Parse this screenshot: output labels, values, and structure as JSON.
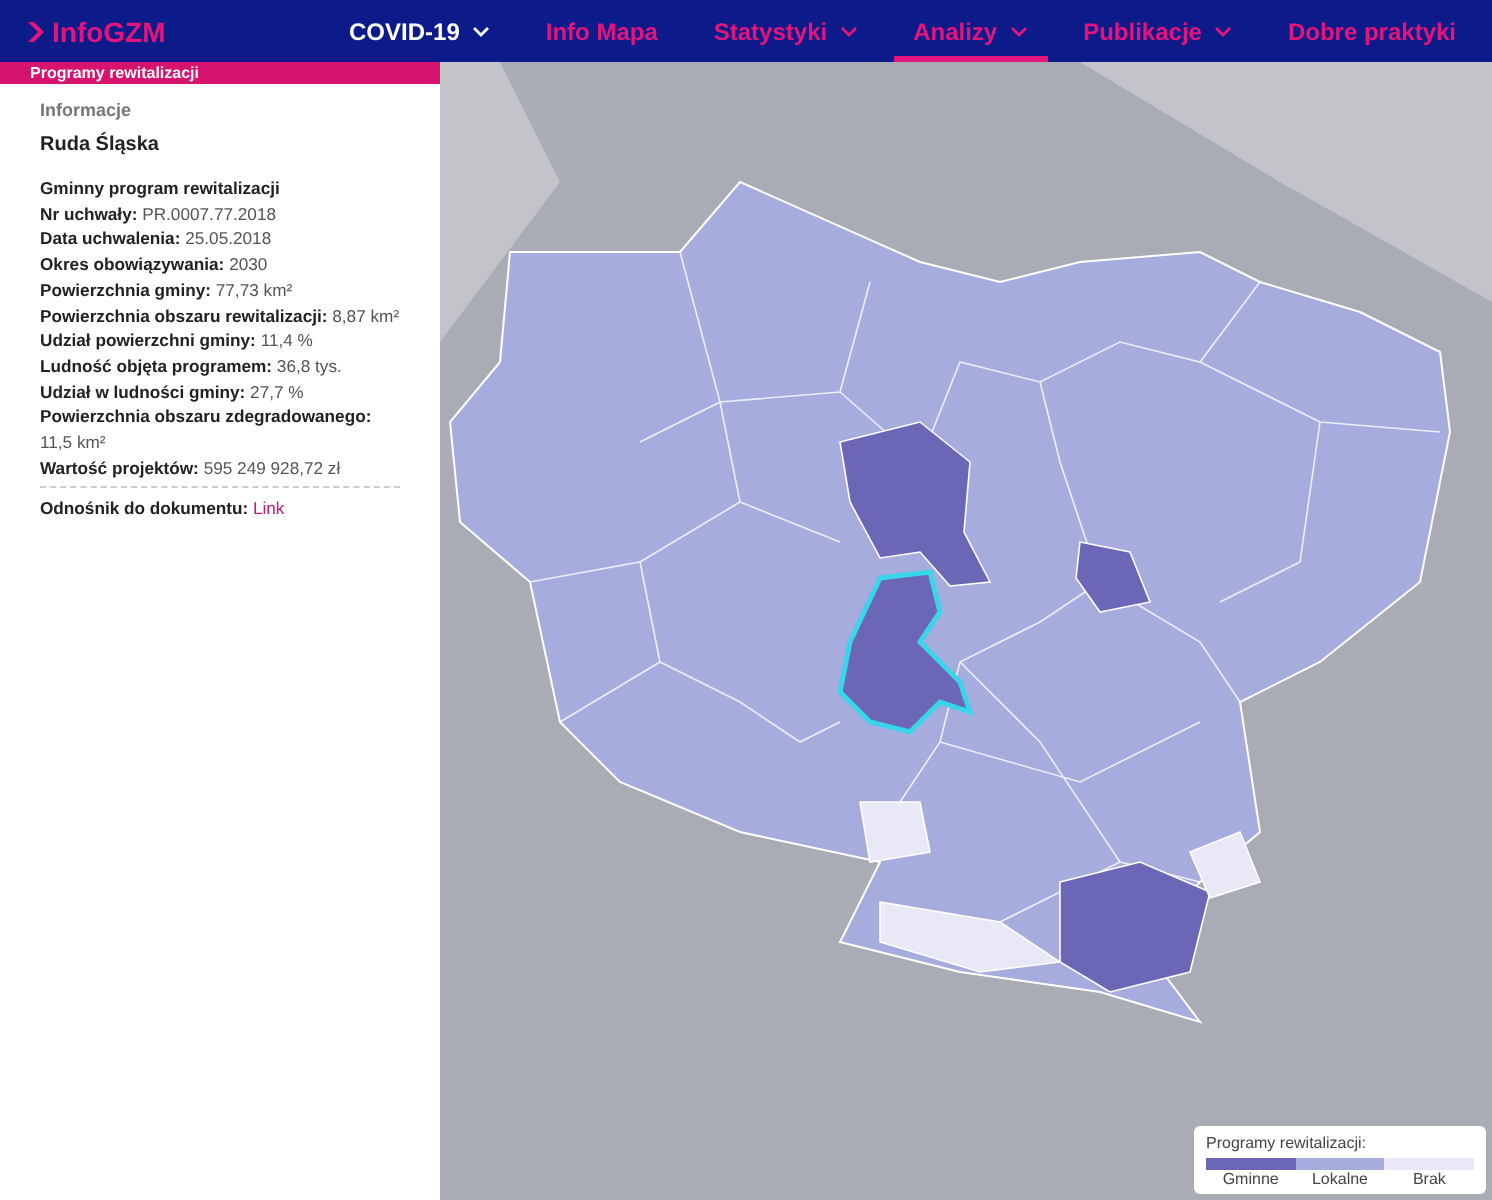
{
  "header": {
    "logo": "InfoGZM",
    "nav": [
      {
        "label": "COVID-19",
        "kind": "featured",
        "dropdown": true,
        "selected": false
      },
      {
        "label": "Info Mapa",
        "kind": "normal",
        "dropdown": false,
        "selected": false
      },
      {
        "label": "Statystyki",
        "kind": "normal",
        "dropdown": true,
        "selected": false
      },
      {
        "label": "Analizy",
        "kind": "normal",
        "dropdown": true,
        "selected": true
      },
      {
        "label": "Publikacje",
        "kind": "normal",
        "dropdown": true,
        "selected": false
      },
      {
        "label": "Dobre praktyki",
        "kind": "normal",
        "dropdown": false,
        "selected": false
      }
    ]
  },
  "panel": {
    "title": "Programy rewitalizacji",
    "section": "Informacje",
    "name": "Ruda Śląska",
    "program": "Gminny program rewitalizacji",
    "fields": [
      {
        "label": "Nr uchwały:",
        "value": "PR.0007.77.2018"
      },
      {
        "label": "Data uchwalenia:",
        "value": "25.05.2018"
      },
      {
        "label": "Okres obowiązywania:",
        "value": "2030"
      },
      {
        "label": "Powierzchnia gminy:",
        "value": "77,73 km²"
      },
      {
        "label": "Powierzchnia obszaru rewitalizacji:",
        "value": "8,87 km²"
      },
      {
        "label": "Udział powierzchni gminy:",
        "value": "11,4 %"
      },
      {
        "label": "Ludność objęta programem:",
        "value": "36,8 tys."
      },
      {
        "label": "Udział w ludności gminy:",
        "value": "27,7 %"
      },
      {
        "label": "Powierzchnia obszaru zdegradowanego:",
        "value": "11,5 km²"
      },
      {
        "label": "Wartość projektów:",
        "value": "595 249 928,72 zł"
      }
    ],
    "link_label": "Odnośnik do dokumentu:",
    "link": "Link"
  },
  "legend": {
    "title": "Programy rewitalizacji:",
    "items": [
      {
        "label": "Gminne",
        "color": "#6c66b6"
      },
      {
        "label": "Lokalne",
        "color": "#a7acdf"
      },
      {
        "label": "Brak",
        "color": "#e9e8f7"
      }
    ]
  }
}
